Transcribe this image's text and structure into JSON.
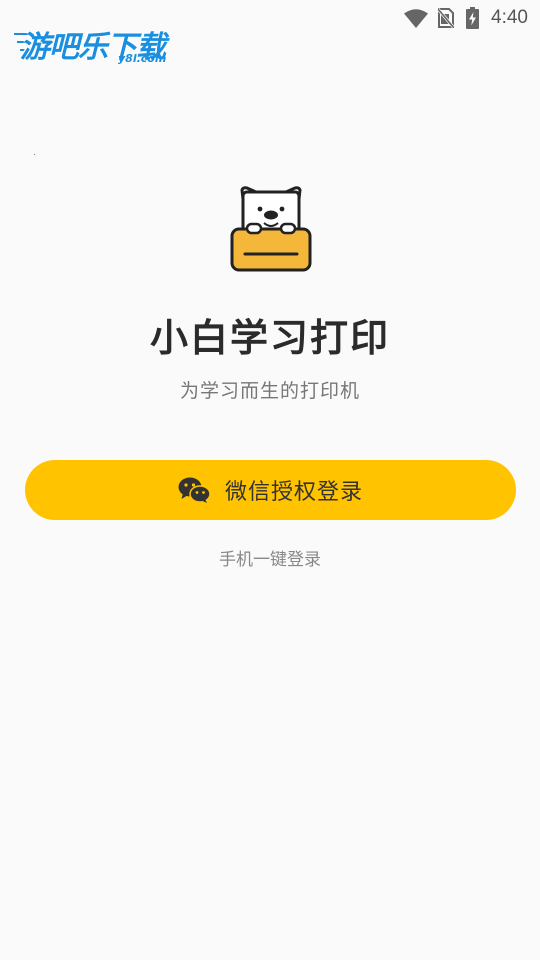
{
  "watermark": {
    "main": "游吧乐下载",
    "sub": "y8l.com"
  },
  "status_bar": {
    "time": "4:40",
    "icons": [
      "wifi-icon",
      "no-sim-icon",
      "battery-charging-icon"
    ]
  },
  "app": {
    "logo_icon": "dog-printer-logo-icon",
    "name": "小白学习打印",
    "slogan": "为学习而生的打印机"
  },
  "login": {
    "wechat_label": "微信授权登录",
    "wechat_icon": "wechat-icon",
    "phone_label": "手机一键登录"
  },
  "colors": {
    "accent": "#ffc300",
    "background": "#fafafa",
    "title": "#2b2b2b",
    "secondary_text": "#888888"
  }
}
